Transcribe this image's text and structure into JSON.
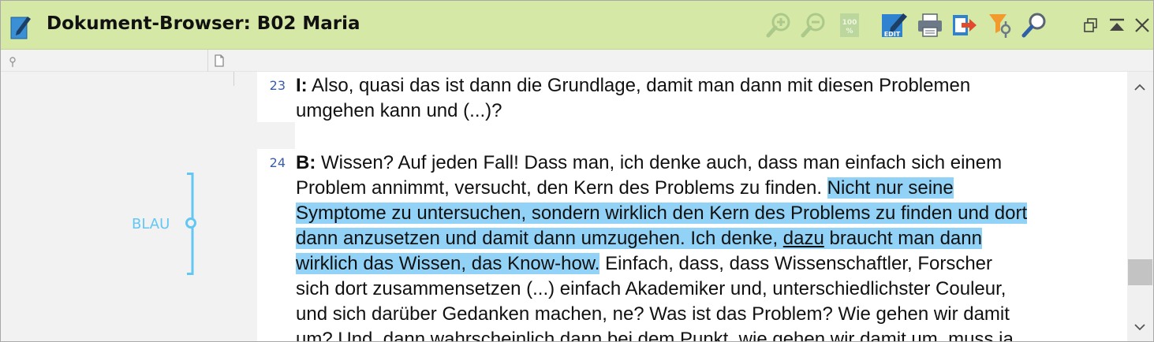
{
  "window": {
    "title": "Dokument-Browser: B02 Maria"
  },
  "toolbar": {
    "icons": [
      "zoom-in-icon",
      "zoom-out-icon",
      "zoom-100-icon",
      "edit-icon",
      "print-icon",
      "export-icon",
      "filter-codes-icon",
      "search-icon",
      "restore-window-icon",
      "collapse-icon",
      "close-icon"
    ],
    "zoom_100_label": "100",
    "edit_label": "EDIT",
    "accent": "#d5e8a6"
  },
  "code_panel": {
    "code_label": "BLAU",
    "code_color": "#63c7f4"
  },
  "document": {
    "highlight_color": "#92d2f6",
    "paragraphs": [
      {
        "number": "23",
        "speaker": "I:",
        "lines": [
          " Also, quasi das ist dann die Grundlage, damit man dann mit diesen Problemen",
          "umgehen kann und (...)?"
        ]
      },
      {
        "number": "24",
        "speaker": "B:",
        "line1": " Wissen? Auf jeden Fall! Dass man, ich denke auch, dass man einfach sich einem",
        "line2_plain": "Problem annimmt, versucht, den Kern des Problems zu finden. ",
        "line2_hl": "Nicht nur seine ",
        "line3_hl": "Symptome zu untersuchen, sondern wirklich den Kern des Problems zu finden und dort",
        "line4_hl_a": "dann anzusetzen und damit dann umzugehen. Ich denke, ",
        "line4_hl_ul": "dazu",
        "line4_hl_b": " braucht man dann ",
        "line5_hl": "wirklich das Wissen, das Know-how.",
        "line5_plain": " Einfach, dass, dass Wissenschaftler, Forscher",
        "line6": "sich dort zusammensetzen (...) einfach Akademiker und, unterschiedlichster Couleur,",
        "line7": "und sich darüber Gedanken machen, ne? Was ist das Problem? Wie gehen wir damit",
        "line8": "um? Und, dann wahrscheinlich dann bei dem Punkt, wie gehen wir damit um, muss ja"
      }
    ]
  }
}
